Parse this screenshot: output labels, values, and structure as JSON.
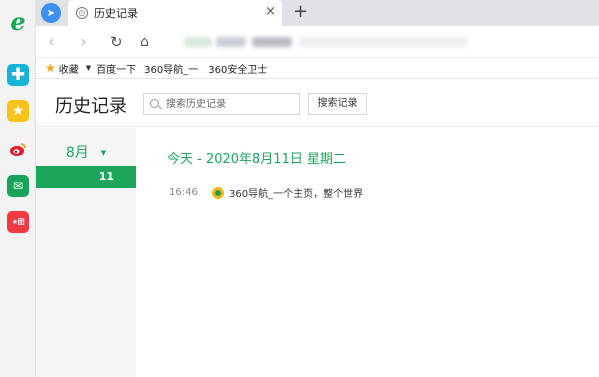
{
  "tab": {
    "title": "历史记录",
    "close": "×",
    "new_tab": "+"
  },
  "toolbar": {
    "back": "‹",
    "forward": "›",
    "reload": "↻",
    "home": "⌂"
  },
  "bookmarks": {
    "favorites_label": "收藏",
    "items": [
      "百度一下",
      "360导航_一",
      "360安全卫士"
    ]
  },
  "header": {
    "title": "历史记录",
    "search_placeholder": "搜索历史记录",
    "search_button": "搜索记录"
  },
  "sidebar": {
    "month": "8月",
    "day": "11"
  },
  "history": {
    "date_heading": "今天 - 2020年8月11日 星期二",
    "entries": [
      {
        "time": "16:46",
        "title": "360导航_一个主页，整个世界",
        "icon": "360-nav-icon"
      }
    ]
  },
  "apps": [
    "ie-browser-icon",
    "plus-icon",
    "star-icon",
    "weibo-icon",
    "mail-icon",
    "shopping-icon"
  ],
  "colors": {
    "accent": "#1ea55c",
    "tabstrip": "#dfe2e6"
  }
}
